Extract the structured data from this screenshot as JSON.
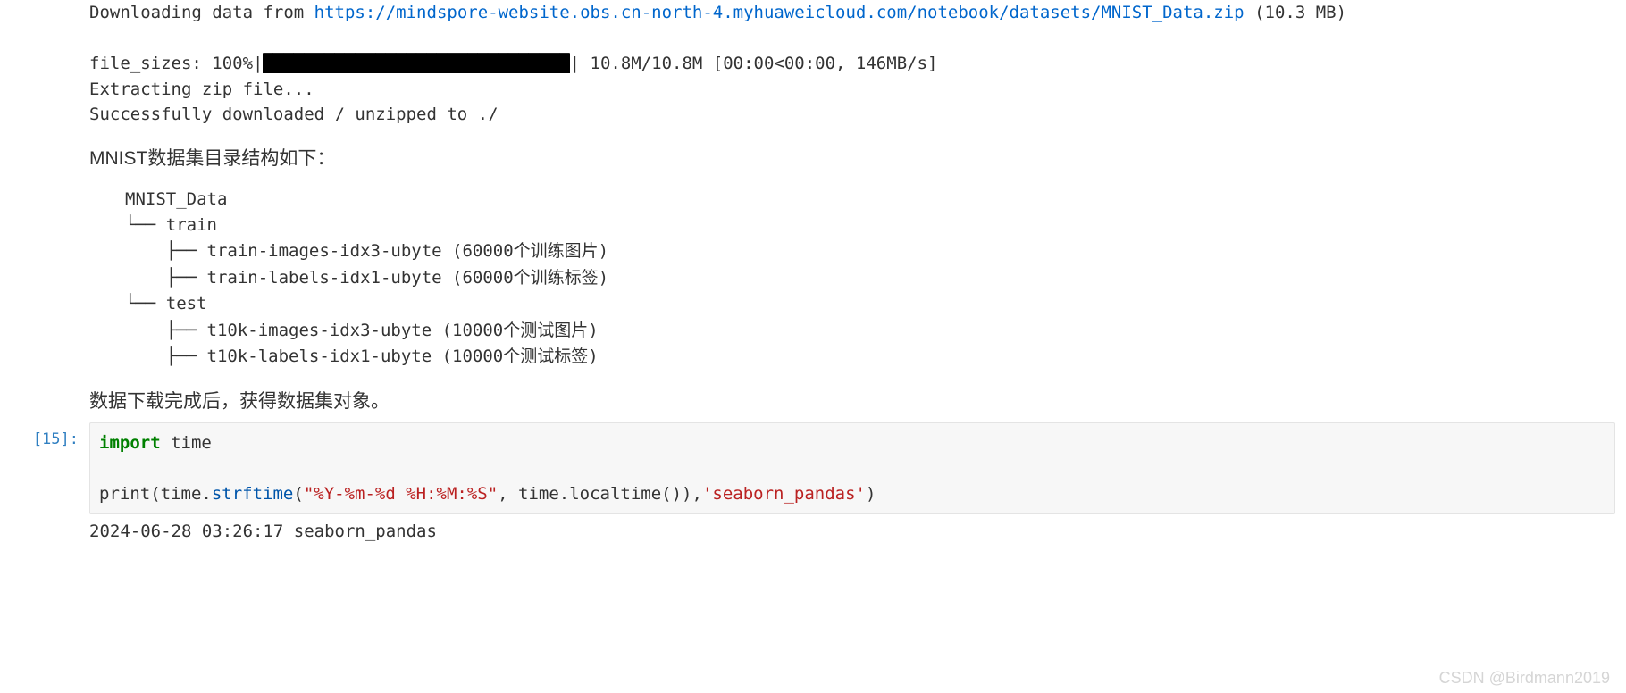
{
  "output": {
    "line1_prefix": "Downloading data from ",
    "line1_url": "https://mindspore-website.obs.cn-north-4.myhuaweicloud.com/notebook/datasets/MNIST_Data.zip",
    "line1_suffix": " (10.3 MB)",
    "progress_label": "file_sizes: 100%|",
    "progress_bar": "██████████████████████████████",
    "progress_stats": "| 10.8M/10.8M [00:00<00:00, 146MB/s]",
    "line_extract": "Extracting zip file...",
    "line_done": "Successfully downloaded / unzipped to ./"
  },
  "md1": "MNIST数据集目录结构如下：",
  "tree": {
    "l1": "MNIST_Data",
    "l2": "└── train",
    "l3": "    ├── train-images-idx3-ubyte (60000个训练图片)",
    "l4": "    ├── train-labels-idx1-ubyte (60000个训练标签)",
    "l5": "└── test",
    "l6": "    ├── t10k-images-idx3-ubyte (10000个测试图片)",
    "l7": "    ├── t10k-labels-idx1-ubyte (10000个测试标签)"
  },
  "md2": "数据下载完成后，获得数据集对象。",
  "cell": {
    "prompt": "[15]:",
    "code": {
      "import_kw": "import",
      "time_mod": " time",
      "print_fn": "print",
      "open_paren": "(time.",
      "strftime_fn": "strftime",
      "open_paren2": "(",
      "fmt_str": "\"%Y-%m-%d %H:%M:%S\"",
      "mid": ", time.localtime()),",
      "sb_str": "'seaborn_pandas'",
      "close": ")"
    },
    "out_text": "2024-06-28 03:26:17 seaborn_pandas"
  },
  "watermark": "CSDN @Birdmann2019"
}
